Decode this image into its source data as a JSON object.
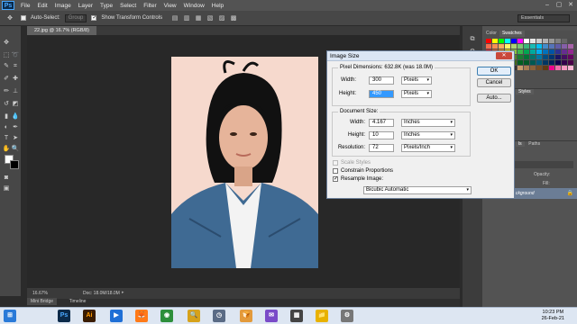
{
  "app": {
    "logo": "Ps",
    "menus": [
      "File",
      "Edit",
      "Image",
      "Layer",
      "Type",
      "Select",
      "Filter",
      "View",
      "Window",
      "Help"
    ],
    "window_controls": [
      "–",
      "▢",
      "✕"
    ]
  },
  "options": {
    "auto_select_label": "Auto-Select:",
    "auto_select_value": "Group",
    "transform_label": "Show Transform Controls",
    "workspace": "Essentials"
  },
  "document": {
    "tab_label": "22.jpg @ 16.7% (RGB/8)",
    "zoom": "16.67%",
    "doc_info": "Doc: 18.0M/18.0M",
    "bottom_tabs": [
      "Mini Bridge",
      "Timeline"
    ]
  },
  "panels": {
    "color_tab": "Color",
    "swatches_tab": "Swatches",
    "styles_tab": "Styles",
    "layers_tabs": [
      "ls",
      "Paths"
    ],
    "opacity_label": "Opacity:",
    "fill_label": "Fill:",
    "layer_name": "ckground",
    "swatch_colors": [
      "#ff0000",
      "#ffff00",
      "#00ff00",
      "#00ffff",
      "#0000ff",
      "#ff00ff",
      "#ffffff",
      "#e6e6e6",
      "#cccccc",
      "#b3b3b3",
      "#999999",
      "#808080",
      "#666666",
      "#4d4d4d",
      "#f26c4f",
      "#f68e55",
      "#fbaf5c",
      "#fff467",
      "#acd372",
      "#7cc576",
      "#3bb878",
      "#1abbb4",
      "#00bff3",
      "#438ccb",
      "#5574b9",
      "#605ca8",
      "#855fa8",
      "#a763a8",
      "#ed1c24",
      "#f26522",
      "#f7941d",
      "#fff200",
      "#8dc63f",
      "#39b54a",
      "#00a651",
      "#00a99d",
      "#00aeef",
      "#0072bc",
      "#0054a6",
      "#2e3192",
      "#662d91",
      "#92278f",
      "#9e0b0f",
      "#a0410d",
      "#a3620a",
      "#aba000",
      "#598527",
      "#1a7b30",
      "#007236",
      "#00746b",
      "#0076a3",
      "#004b80",
      "#003471",
      "#1b1464",
      "#440e62",
      "#630460",
      "#790000",
      "#7b2e00",
      "#7d4900",
      "#827b00",
      "#406618",
      "#005e20",
      "#005826",
      "#005952",
      "#005b7f",
      "#003663",
      "#002157",
      "#0d004c",
      "#32004b",
      "#4b0049",
      "#c7b299",
      "#998675",
      "#736357",
      "#534741",
      "#37302d",
      "#c69c6d",
      "#a67c52",
      "#8c6239",
      "#754c24",
      "#603913",
      "#ec008c",
      "#f06eaa",
      "#f49ac2",
      "#f7b5d3"
    ]
  },
  "dialog": {
    "title": "Image Size",
    "close": "✕",
    "pixel_dimensions_label": "Pixel Dimensions:",
    "pixel_dimensions_value": "632.8K (was 18.0M)",
    "px_width_label": "Width:",
    "px_width_value": "300",
    "px_width_unit": "Pixels",
    "px_height_label": "Height:",
    "px_height_value": "450",
    "px_height_unit": "Pixels",
    "document_size_label": "Document Size:",
    "doc_width_label": "Width:",
    "doc_width_value": "4.167",
    "doc_width_unit": "Inches",
    "doc_height_label": "Height:",
    "doc_height_value": "10",
    "doc_height_unit": "Inches",
    "resolution_label": "Resolution:",
    "resolution_value": "72",
    "resolution_unit": "Pixels/Inch",
    "scale_styles_label": "Scale Styles",
    "constrain_label": "Constrain Proportions",
    "resample_label": "Resample Image:",
    "resample_method": "Bicubic Automatic",
    "ok_label": "OK",
    "cancel_label": "Cancel",
    "auto_label": "Auto..."
  },
  "taskbar": {
    "time": "10:23 PM",
    "date": "26-Feb-21",
    "apps": [
      "⊞",
      "Ps",
      "Ai",
      "▶",
      "🦊",
      "◉",
      "🔍",
      "◷",
      "🍞",
      "✉",
      "▦",
      "📁",
      "⚙"
    ]
  }
}
